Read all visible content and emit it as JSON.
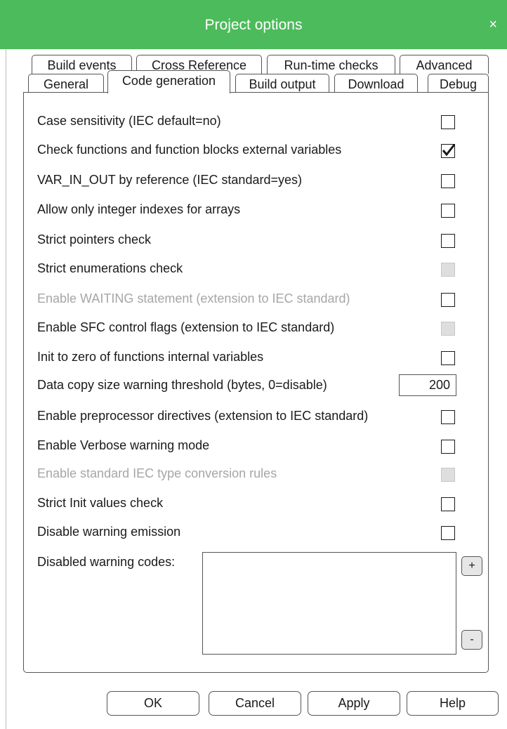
{
  "window": {
    "title": "Project options",
    "close_glyph": "×",
    "close_icon": "close-icon"
  },
  "colors": {
    "titlebar": "#4cbb5b",
    "title_text": "#ffffff",
    "disabled_text": "#a6a6a6",
    "disabled_checkbox": "#dedede"
  },
  "tabs_row1": [
    "Build events",
    "Cross Reference",
    "Run-time checks",
    "Advanced"
  ],
  "tabs_row2": [
    "General",
    "Code generation",
    "Build output",
    "Download",
    "Debug"
  ],
  "active_tab": "Code generation",
  "options": [
    {
      "label": "Case sensitivity (IEC default=no)",
      "checked": false,
      "label_enabled": true,
      "checkbox_enabled": true
    },
    {
      "label": "Check functions and function blocks external variables",
      "checked": true,
      "label_enabled": true,
      "checkbox_enabled": true
    },
    {
      "label": "VAR_IN_OUT by reference (IEC standard=yes)",
      "checked": false,
      "label_enabled": true,
      "checkbox_enabled": true
    },
    {
      "label": "Allow only integer indexes for arrays",
      "checked": false,
      "label_enabled": true,
      "checkbox_enabled": true
    },
    {
      "label": "Strict pointers check",
      "checked": false,
      "label_enabled": true,
      "checkbox_enabled": true
    },
    {
      "label": "Strict enumerations check",
      "checked": false,
      "label_enabled": true,
      "checkbox_enabled": false
    },
    {
      "label": "Enable WAITING statement (extension to IEC standard)",
      "checked": false,
      "label_enabled": false,
      "checkbox_enabled": true
    },
    {
      "label": "Enable SFC control flags (extension to IEC standard)",
      "checked": false,
      "label_enabled": true,
      "checkbox_enabled": false
    },
    {
      "label": "Init to zero of functions internal variables",
      "checked": false,
      "label_enabled": true,
      "checkbox_enabled": true
    },
    {
      "label": "Enable preprocessor directives (extension to IEC standard)",
      "checked": false,
      "label_enabled": true,
      "checkbox_enabled": true
    },
    {
      "label": "Enable Verbose warning mode",
      "checked": false,
      "label_enabled": true,
      "checkbox_enabled": true
    },
    {
      "label": "Enable standard IEC type conversion rules",
      "checked": false,
      "label_enabled": false,
      "checkbox_enabled": false
    },
    {
      "label": "Strict Init values check",
      "checked": false,
      "label_enabled": true,
      "checkbox_enabled": true
    },
    {
      "label": "Disable warning emission",
      "checked": false,
      "label_enabled": true,
      "checkbox_enabled": true
    }
  ],
  "data_copy": {
    "label": "Data copy size warning threshold (bytes, 0=disable)",
    "value": "200"
  },
  "disabled_warnings": {
    "label": "Disabled warning codes:",
    "add_label": "+",
    "remove_label": "-"
  },
  "buttons": {
    "ok": "OK",
    "cancel": "Cancel",
    "apply": "Apply",
    "help": "Help"
  }
}
